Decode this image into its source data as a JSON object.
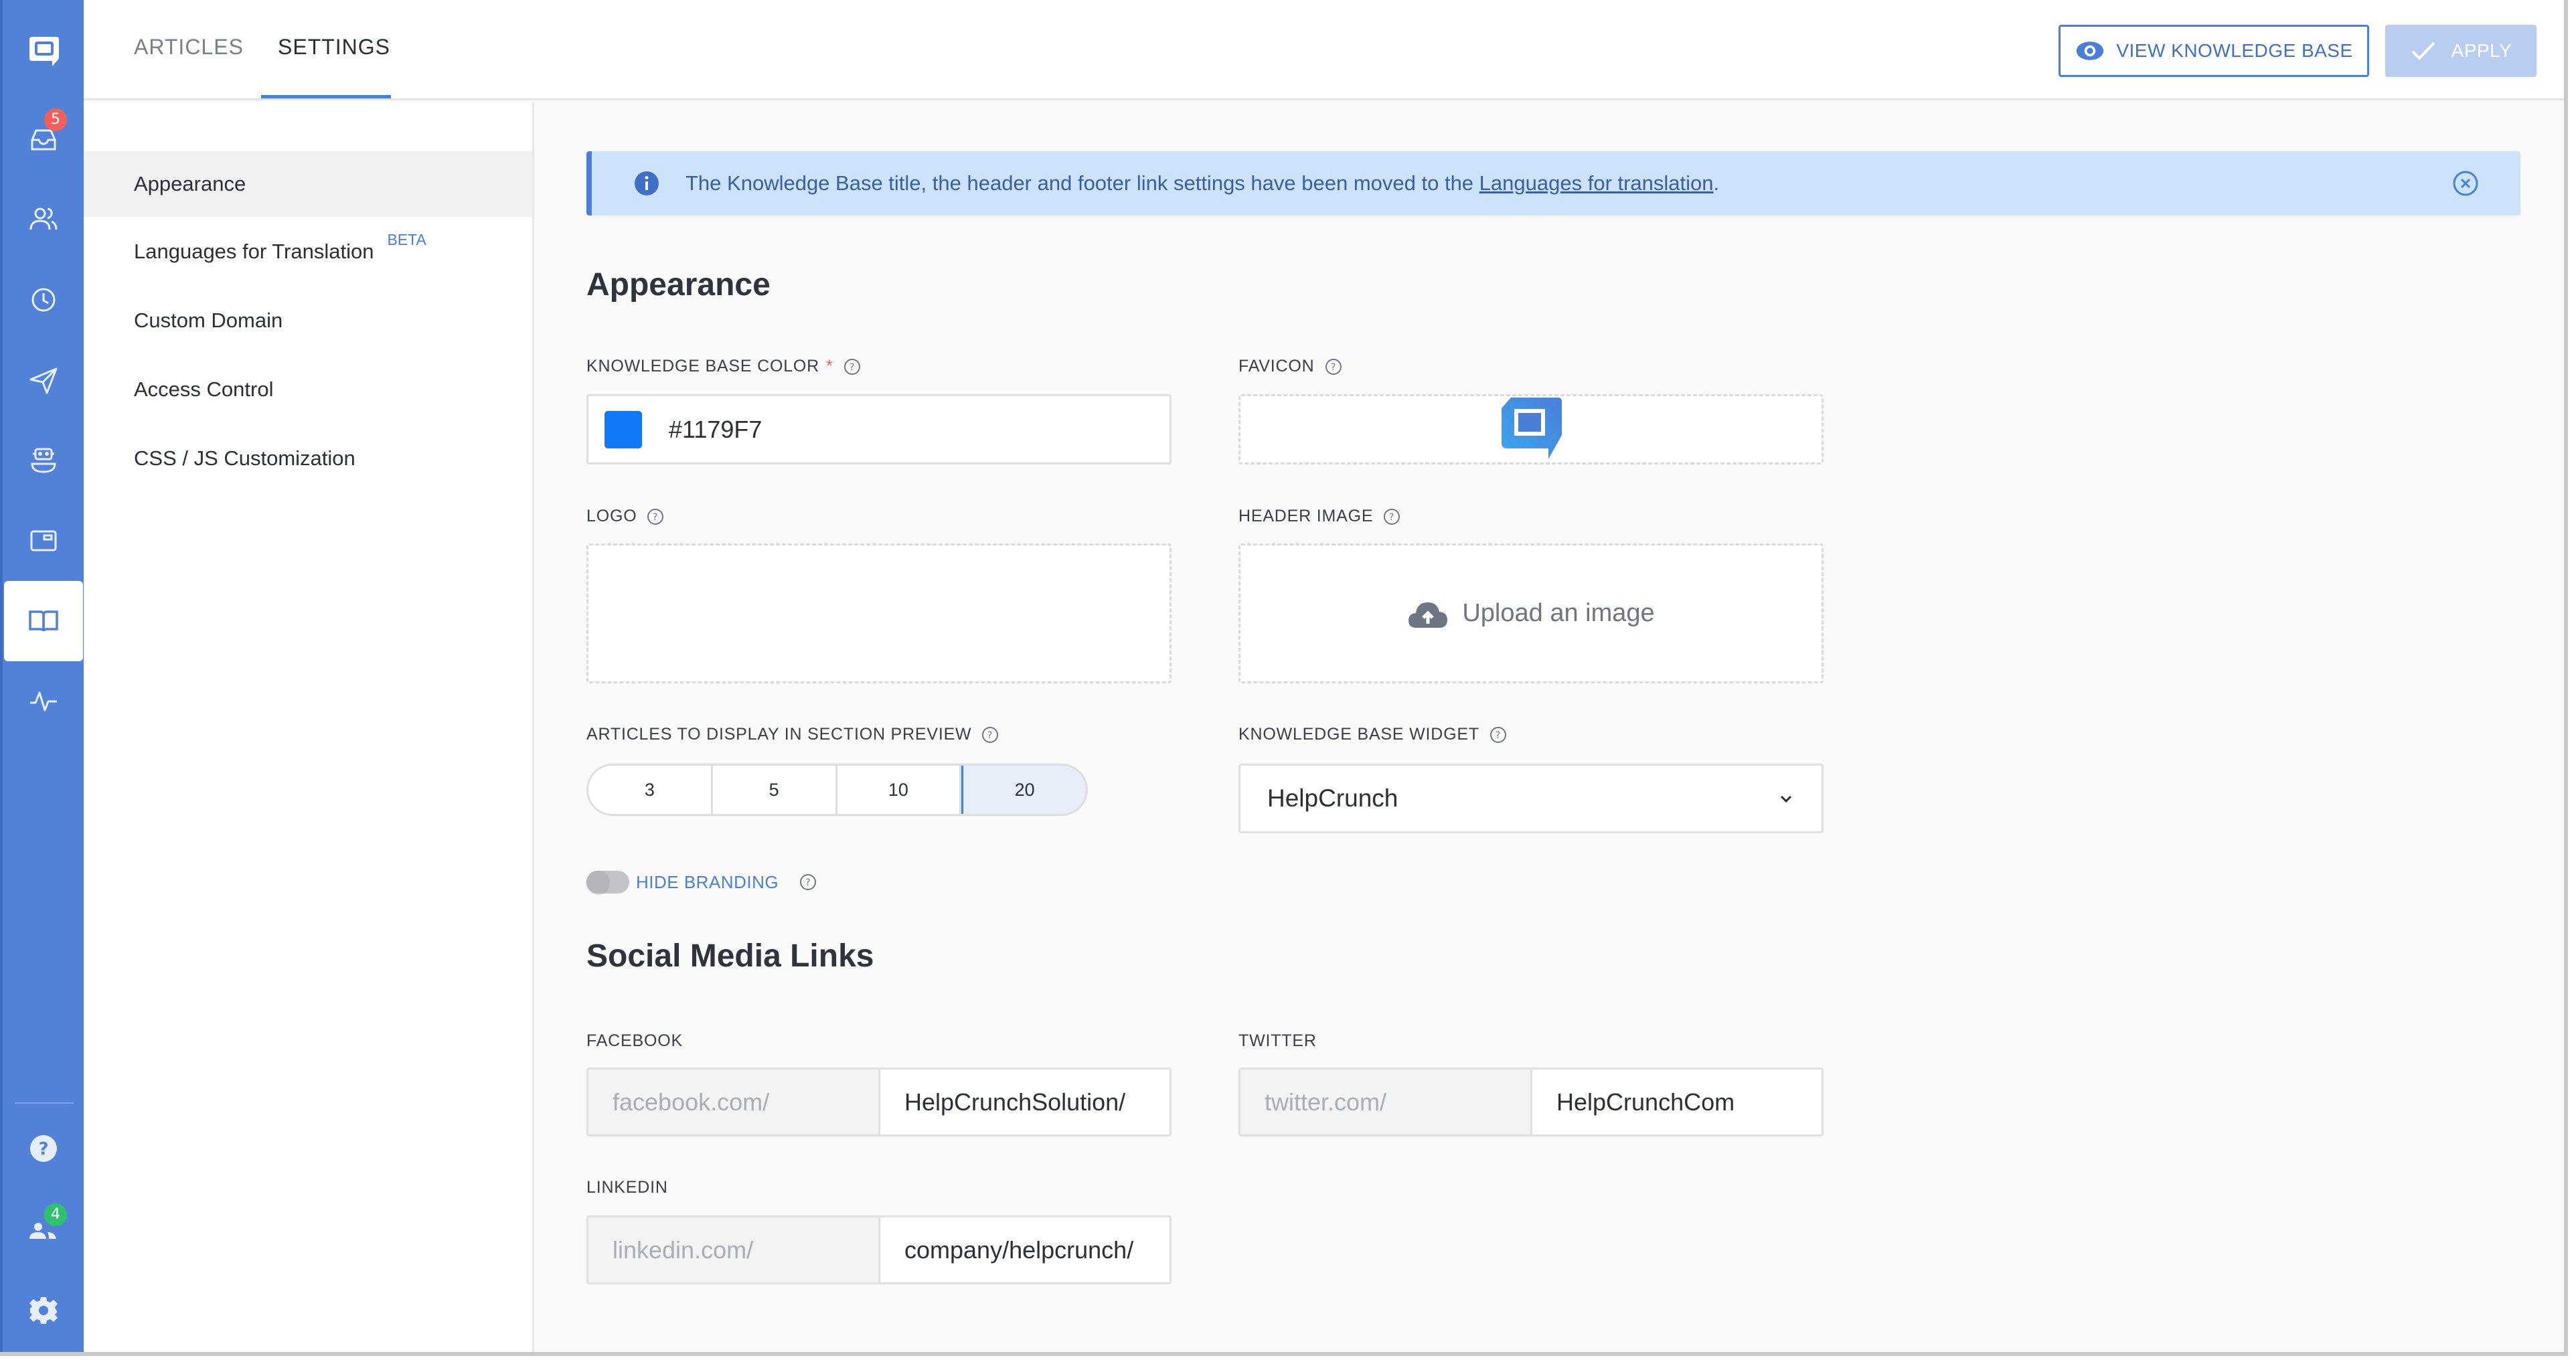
{
  "sidebar": {
    "items": [
      {
        "name": "logo",
        "icon": "helpcrunch-logo-icon"
      },
      {
        "name": "inbox",
        "icon": "inbox-icon",
        "badge": "5"
      },
      {
        "name": "contacts",
        "icon": "users-icon"
      },
      {
        "name": "history",
        "icon": "clock-icon"
      },
      {
        "name": "campaigns",
        "icon": "send-icon"
      },
      {
        "name": "chatbot",
        "icon": "bot-icon"
      },
      {
        "name": "popups",
        "icon": "window-icon"
      },
      {
        "name": "knowledge-base",
        "icon": "book-open-icon",
        "active": true
      },
      {
        "name": "reports",
        "icon": "activity-icon"
      }
    ],
    "bottom": [
      {
        "name": "help",
        "icon": "help-circle-icon"
      },
      {
        "name": "team",
        "icon": "team-icon",
        "badge": "4"
      },
      {
        "name": "settings",
        "icon": "gear-icon"
      }
    ]
  },
  "header": {
    "tabs": [
      {
        "label": "ARTICLES",
        "active": false
      },
      {
        "label": "SETTINGS",
        "active": true
      }
    ],
    "view_button": "VIEW KNOWLEDGE BASE",
    "apply_button": "APPLY"
  },
  "nav": {
    "items": [
      {
        "label": "Appearance",
        "active": true
      },
      {
        "label": "Languages for Translation",
        "badge": "BETA"
      },
      {
        "label": "Custom Domain"
      },
      {
        "label": "Access Control"
      },
      {
        "label": "CSS / JS Customization"
      }
    ]
  },
  "banner": {
    "message": "The Knowledge Base title, the header and footer link settings have been moved to the ",
    "link": "Languages for translation",
    "suffix": "."
  },
  "appearance": {
    "title": "Appearance",
    "color_label": "KNOWLEDGE BASE COLOR",
    "color_required": "*",
    "color_value": "#1179F7",
    "favicon_label": "FAVICON",
    "logo_label": "LOGO",
    "header_image_label": "HEADER IMAGE",
    "upload_text": "Upload an image",
    "articles_label": "ARTICLES TO DISPLAY IN SECTION PREVIEW",
    "articles_options": [
      "3",
      "5",
      "10",
      "20"
    ],
    "articles_selected": "20",
    "widget_label": "KNOWLEDGE BASE WIDGET",
    "widget_value": "HelpCrunch",
    "hide_branding_label": "HIDE BRANDING",
    "hide_branding_on": false
  },
  "social": {
    "title": "Social Media Links",
    "facebook": {
      "label": "FACEBOOK",
      "prefix": "facebook.com/",
      "value": "HelpCrunchSolution/"
    },
    "twitter": {
      "label": "TWITTER",
      "prefix": "twitter.com/",
      "value": "HelpCrunchCom"
    },
    "linkedin": {
      "label": "LINKEDIN",
      "prefix": "linkedin.com/",
      "value": "company/helpcrunch/"
    }
  },
  "colors": {
    "sidebar": "#5282d8",
    "accent": "#4a7fd8",
    "kb_color": "#1179F7",
    "badge_red": "#f25f5c",
    "badge_green": "#2ec26c",
    "banner_bg": "#cce3fb"
  }
}
